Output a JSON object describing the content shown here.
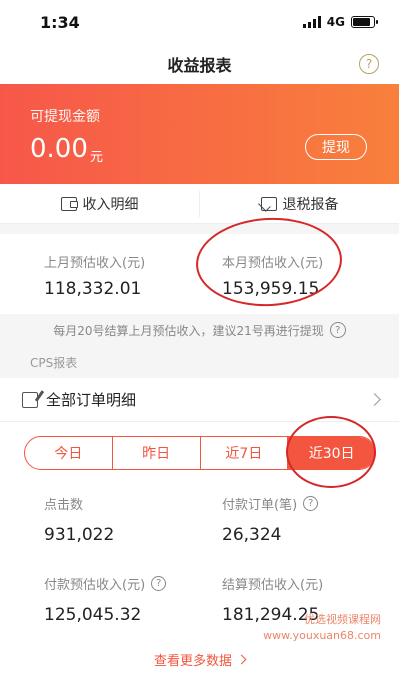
{
  "status_bar": {
    "time": "1:34",
    "network": "4G",
    "battery_level": 0.85
  },
  "header": {
    "title": "收益报表",
    "help_icon": "question-circle-icon"
  },
  "banner": {
    "label": "可提现金额",
    "amount": "0.00",
    "unit": "元",
    "withdraw_label": "提现",
    "gradient_colors": [
      "#f7574a",
      "#f8803c"
    ]
  },
  "actions": {
    "income_detail_label": "收入明细",
    "income_detail_icon": "wallet-icon",
    "tax_label": "退税报备",
    "tax_icon": "mail-icon"
  },
  "estimate": {
    "last_month_label": "上月预估收入(元)",
    "last_month_value": "118,332.01",
    "this_month_label": "本月预估收入(元)",
    "this_month_value": "153,959.15"
  },
  "notice": {
    "text": "每月20号结算上月预估收入，建议21号再进行提现"
  },
  "cps": {
    "section_label": "CPS报表",
    "orders_label": "全部订单明细"
  },
  "tabs": [
    {
      "label": "今日",
      "active": false
    },
    {
      "label": "昨日",
      "active": false
    },
    {
      "label": "近7日",
      "active": false
    },
    {
      "label": "近30日",
      "active": true
    }
  ],
  "stats": {
    "clicks_label": "点击数",
    "clicks_value": "931,022",
    "paid_orders_label": "付款订单(笔)",
    "paid_orders_value": "26,324",
    "paid_estimate_label": "付款预估收入(元)",
    "paid_estimate_value": "125,045.32",
    "settled_estimate_label": "结算预估收入(元)",
    "settled_estimate_value": "181,294.25"
  },
  "more_link": {
    "label": "查看更多数据"
  },
  "watermark": {
    "line1": "优选视频课程网",
    "line2": "www.youxuan68.com"
  },
  "accent_color": "#f4553f",
  "annotation_color": "#d62828"
}
